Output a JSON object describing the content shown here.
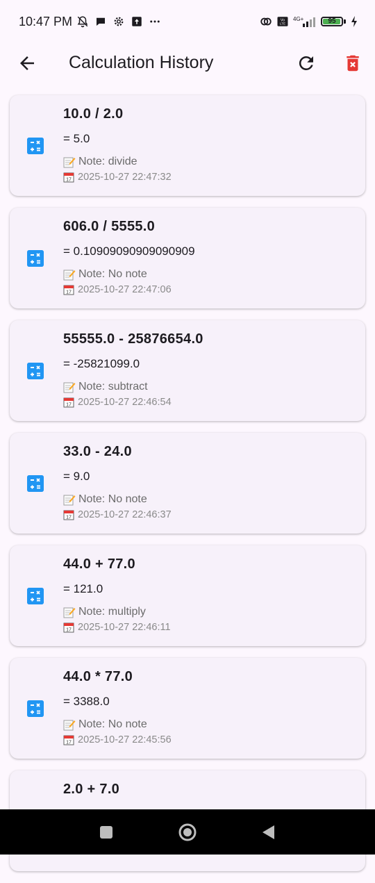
{
  "status_bar": {
    "time": "10:47 PM",
    "left_icons": [
      "silent-bell-icon",
      "chat-bubble-icon",
      "settings-cog-icon",
      "upload-icon",
      "more-dots-icon"
    ],
    "right_icons": [
      "hotspot-icon",
      "volte-icon",
      "signal-4g-icon",
      "battery-icon"
    ],
    "network": "4G+",
    "battery_level": "95",
    "battery_fraction": 0.95
  },
  "app_bar": {
    "title": "Calculation History",
    "back_icon": "arrow-back-icon",
    "refresh_icon": "refresh-icon",
    "delete_icon": "delete-sweep-icon"
  },
  "colors": {
    "accent_icon": "#2196f3",
    "delete_red": "#e53935",
    "card_bg": "#f7f1fa",
    "page_bg": "#fdf7fe"
  },
  "history": [
    {
      "expression": "10.0 / 2.0",
      "result": "= 5.0",
      "note": "Note: divide",
      "date": "2025-10-27 22:47:32"
    },
    {
      "expression": "606.0 / 5555.0",
      "result": "= 0.10909090909090909",
      "note": "Note: No note",
      "date": "2025-10-27 22:47:06"
    },
    {
      "expression": "55555.0 - 25876654.0",
      "result": "= -25821099.0",
      "note": "Note: subtract",
      "date": "2025-10-27 22:46:54"
    },
    {
      "expression": "33.0 - 24.0",
      "result": "= 9.0",
      "note": "Note: No note",
      "date": "2025-10-27 22:46:37"
    },
    {
      "expression": "44.0 + 77.0",
      "result": "= 121.0",
      "note": "Note: multiply",
      "date": "2025-10-27 22:46:11"
    },
    {
      "expression": "44.0 * 77.0",
      "result": "= 3388.0",
      "note": "Note: No note",
      "date": "2025-10-27 22:45:56"
    },
    {
      "expression": "2.0 + 7.0",
      "result": "",
      "note": "",
      "date": ""
    }
  ],
  "nav_bar": {
    "icons": [
      "recents-square-icon",
      "home-circle-icon",
      "back-triangle-icon"
    ]
  }
}
